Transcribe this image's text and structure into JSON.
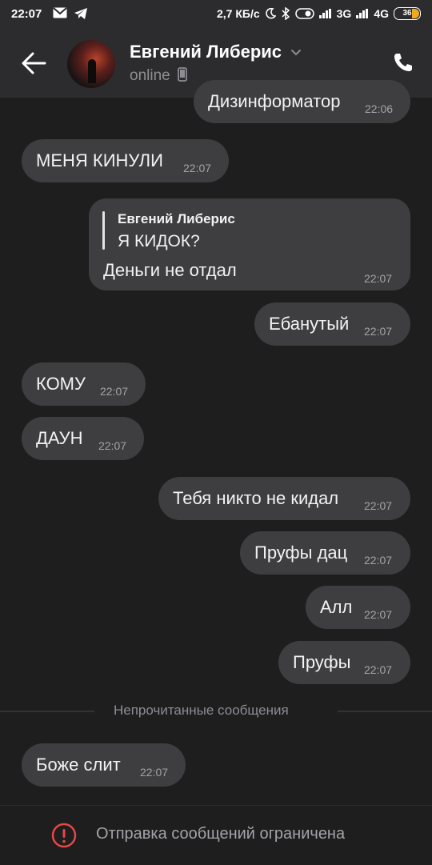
{
  "status_bar": {
    "time": "22:07",
    "speed": "2,7 КБ/с",
    "net1": "3G",
    "net2": "4G",
    "battery": "36"
  },
  "header": {
    "name": "Евгений Либерис",
    "status": "online"
  },
  "messages": [
    {
      "side": "out",
      "text": "Дизинформатор",
      "time": "22:06"
    },
    {
      "side": "in",
      "text": "МЕНЯ КИНУЛИ",
      "time": "22:07"
    },
    {
      "side": "out",
      "reply_author": "Евгений Либерис",
      "reply_text": "Я КИДОК?",
      "text": "Деньги не отдал",
      "time": "22:07"
    },
    {
      "side": "out",
      "text": "Ебанутый",
      "time": "22:07"
    },
    {
      "side": "in",
      "text": "КОМУ",
      "time": "22:07"
    },
    {
      "side": "in",
      "text": "ДАУН",
      "time": "22:07"
    },
    {
      "side": "out",
      "text": "Тебя никто не кидал",
      "time": "22:07"
    },
    {
      "side": "out",
      "text": "Пруфы дац",
      "time": "22:07"
    },
    {
      "side": "out",
      "text": "Алл",
      "time": "22:07"
    },
    {
      "side": "out",
      "text": "Пруфы",
      "time": "22:07"
    },
    {
      "side": "in",
      "text": "Боже слит",
      "time": "22:07"
    }
  ],
  "unread_divider": "Непрочитанные сообщения",
  "footer": {
    "restricted_text": "Отправка сообщений ограничена"
  },
  "colors": {
    "background": "#1e1e1f",
    "bubble": "#3e3e40",
    "header": "#2c2c2e",
    "warning": "#e64646"
  }
}
